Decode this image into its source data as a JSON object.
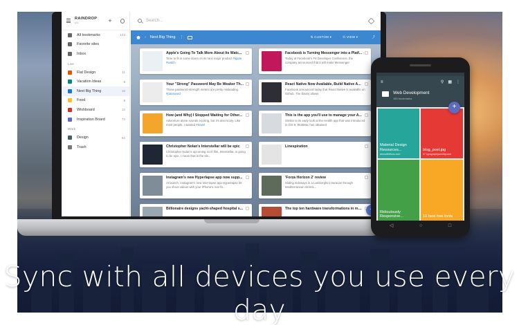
{
  "tagline": "Sync with all devices you use every day",
  "laptop": {
    "brand": "RAINDROP",
    "brand_super": "(4)",
    "search_placeholder": "Search...",
    "toolbar": {
      "collection": "Next Big Thing",
      "sort_label": "CUSTOM",
      "view_label": "VIEW"
    },
    "sidebar": {
      "top_items": [
        {
          "label": "All bookmarks",
          "count": "144",
          "icon": "cloud-icon"
        },
        {
          "label": "Favorite sites",
          "count": "",
          "icon": "star-icon"
        },
        {
          "label": "Inbox",
          "count": "",
          "icon": "inbox-icon"
        }
      ],
      "section_live": "Live",
      "live_items": [
        {
          "label": "Flat Design",
          "count": "11",
          "color": "#e65100"
        },
        {
          "label": "Vacation Ideas",
          "count": "9",
          "color": "#00897b"
        },
        {
          "label": "Next Big Thing",
          "count": "18",
          "color": "#1976d2"
        },
        {
          "label": "Food",
          "count": "8",
          "color": "#fbc02d"
        },
        {
          "label": "Wishboard",
          "count": "13",
          "color": "#d32f2f"
        },
        {
          "label": "Inspiration Board",
          "count": "74",
          "color": "#5c6bc0"
        }
      ],
      "section_work": "Work",
      "work_items": [
        {
          "label": "Design",
          "count": "53",
          "color": "#455a64"
        },
        {
          "label": "Trash",
          "count": "",
          "color": "#777777"
        }
      ]
    },
    "cards": [
      {
        "title": "Apple's Going To Talk More About Its Watc...",
        "desc": "Time to fit in some doors on its next major product",
        "tags": "#apple #watch",
        "thumb": "#e9f1f5"
      },
      {
        "title": "Facebook is Turning Messenger into a Platf...",
        "desc": "Today at Facebook's F8 Developer Conference, the company announced that it will make Messenger",
        "tags": "",
        "thumb": "#c2185b"
      },
      {
        "title": "Your \"Strong\" Password May Be Weaker Th...",
        "desc": "Those password-strength meters are pretty misleading.",
        "tags": "#password",
        "thumb": "#ececec"
      },
      {
        "title": "React Native Now Available, Build Native A...",
        "desc": "Facebook announced today that React Native is available on Github. The library allows",
        "tags": "",
        "thumb": "#2d2f35"
      },
      {
        "title": "How (and Why) I Stopped Waiting for Other...",
        "desc": "Adventure alone sounds exciting, but it's also scary. Like most people, I wanted",
        "tags": "#travel",
        "thumb": "#f4a52c"
      },
      {
        "title": "This is the app you'll use to manage your A...",
        "desc": "Similar to its early look at the Health app that was introduced in iOS 8, 9to5Mac has obtained",
        "tags": "",
        "thumb": "#d7dbe0"
      },
      {
        "title": "Christopher Nolan's Interstellar will be epic",
        "desc": "Christopher Nolan's upcoming sci-fi film, Interstellar, is going to be epic. I mean that in the sle...",
        "tags": "",
        "thumb": "#1e2733"
      },
      {
        "title": "Linespiration",
        "desc": "",
        "tags": "",
        "thumb": "#e4e4e4"
      },
      {
        "title": "Instagram's new Hyperlapse app now supp...",
        "desc": "At launch, Instagram's new time-lapse app Hyperlapse let you shoot videos with your iPhone's rear fa...",
        "tags": "",
        "thumb": "#7f8d99"
      },
      {
        "title": "'Forza Horizon 2' review",
        "desc": "Sliding sideways in a Lamborghini Huracan through Mediterranean streets...",
        "tags": "",
        "thumb": "#5e6a5a"
      },
      {
        "title": "Billionaire designs yacht-shaped hospital s...",
        "desc": "",
        "tags": "",
        "thumb": "#9aa7b0"
      },
      {
        "title": "The top ten hardware transformations in mo...",
        "desc": "",
        "tags": "",
        "thumb": "#b44d33"
      }
    ],
    "fab": "+"
  },
  "phone": {
    "collection_title": "Web Development",
    "collection_sub": "150 bookmarks",
    "fab": "+",
    "tiles": [
      {
        "title": "Material Design Resources...",
        "sub": "amourtbitious.com",
        "color": "#26a69a"
      },
      {
        "title": "blog_post.jpg",
        "sub": "37 typographyweekly.com",
        "color": "#e53935"
      },
      {
        "title": "Ridiculously Responsive...",
        "sub": "",
        "color": "#43a047"
      },
      {
        "title": "10 best free fonts",
        "sub": "",
        "color": "#f9a825"
      }
    ]
  },
  "colors": {
    "accent_blue": "#3d87d1",
    "fab_indigo": "#5a72d8",
    "phone_appbar": "#37474f"
  }
}
